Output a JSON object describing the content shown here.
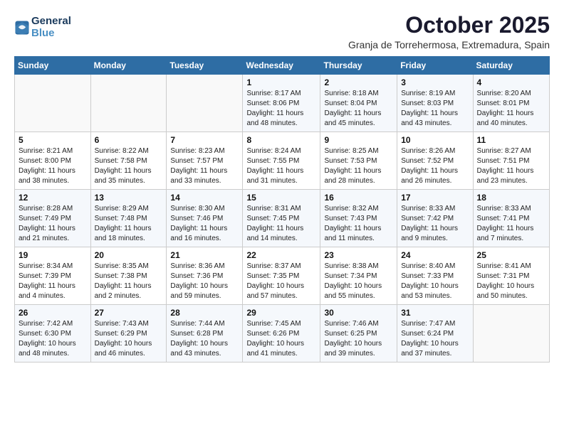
{
  "logo": {
    "line1": "General",
    "line2": "Blue"
  },
  "title": "October 2025",
  "subtitle": "Granja de Torrehermosa, Extremadura, Spain",
  "weekdays": [
    "Sunday",
    "Monday",
    "Tuesday",
    "Wednesday",
    "Thursday",
    "Friday",
    "Saturday"
  ],
  "weeks": [
    [
      {
        "day": "",
        "info": ""
      },
      {
        "day": "",
        "info": ""
      },
      {
        "day": "",
        "info": ""
      },
      {
        "day": "1",
        "info": "Sunrise: 8:17 AM\nSunset: 8:06 PM\nDaylight: 11 hours\nand 48 minutes."
      },
      {
        "day": "2",
        "info": "Sunrise: 8:18 AM\nSunset: 8:04 PM\nDaylight: 11 hours\nand 45 minutes."
      },
      {
        "day": "3",
        "info": "Sunrise: 8:19 AM\nSunset: 8:03 PM\nDaylight: 11 hours\nand 43 minutes."
      },
      {
        "day": "4",
        "info": "Sunrise: 8:20 AM\nSunset: 8:01 PM\nDaylight: 11 hours\nand 40 minutes."
      }
    ],
    [
      {
        "day": "5",
        "info": "Sunrise: 8:21 AM\nSunset: 8:00 PM\nDaylight: 11 hours\nand 38 minutes."
      },
      {
        "day": "6",
        "info": "Sunrise: 8:22 AM\nSunset: 7:58 PM\nDaylight: 11 hours\nand 35 minutes."
      },
      {
        "day": "7",
        "info": "Sunrise: 8:23 AM\nSunset: 7:57 PM\nDaylight: 11 hours\nand 33 minutes."
      },
      {
        "day": "8",
        "info": "Sunrise: 8:24 AM\nSunset: 7:55 PM\nDaylight: 11 hours\nand 31 minutes."
      },
      {
        "day": "9",
        "info": "Sunrise: 8:25 AM\nSunset: 7:53 PM\nDaylight: 11 hours\nand 28 minutes."
      },
      {
        "day": "10",
        "info": "Sunrise: 8:26 AM\nSunset: 7:52 PM\nDaylight: 11 hours\nand 26 minutes."
      },
      {
        "day": "11",
        "info": "Sunrise: 8:27 AM\nSunset: 7:51 PM\nDaylight: 11 hours\nand 23 minutes."
      }
    ],
    [
      {
        "day": "12",
        "info": "Sunrise: 8:28 AM\nSunset: 7:49 PM\nDaylight: 11 hours\nand 21 minutes."
      },
      {
        "day": "13",
        "info": "Sunrise: 8:29 AM\nSunset: 7:48 PM\nDaylight: 11 hours\nand 18 minutes."
      },
      {
        "day": "14",
        "info": "Sunrise: 8:30 AM\nSunset: 7:46 PM\nDaylight: 11 hours\nand 16 minutes."
      },
      {
        "day": "15",
        "info": "Sunrise: 8:31 AM\nSunset: 7:45 PM\nDaylight: 11 hours\nand 14 minutes."
      },
      {
        "day": "16",
        "info": "Sunrise: 8:32 AM\nSunset: 7:43 PM\nDaylight: 11 hours\nand 11 minutes."
      },
      {
        "day": "17",
        "info": "Sunrise: 8:33 AM\nSunset: 7:42 PM\nDaylight: 11 hours\nand 9 minutes."
      },
      {
        "day": "18",
        "info": "Sunrise: 8:33 AM\nSunset: 7:41 PM\nDaylight: 11 hours\nand 7 minutes."
      }
    ],
    [
      {
        "day": "19",
        "info": "Sunrise: 8:34 AM\nSunset: 7:39 PM\nDaylight: 11 hours\nand 4 minutes."
      },
      {
        "day": "20",
        "info": "Sunrise: 8:35 AM\nSunset: 7:38 PM\nDaylight: 11 hours\nand 2 minutes."
      },
      {
        "day": "21",
        "info": "Sunrise: 8:36 AM\nSunset: 7:36 PM\nDaylight: 10 hours\nand 59 minutes."
      },
      {
        "day": "22",
        "info": "Sunrise: 8:37 AM\nSunset: 7:35 PM\nDaylight: 10 hours\nand 57 minutes."
      },
      {
        "day": "23",
        "info": "Sunrise: 8:38 AM\nSunset: 7:34 PM\nDaylight: 10 hours\nand 55 minutes."
      },
      {
        "day": "24",
        "info": "Sunrise: 8:40 AM\nSunset: 7:33 PM\nDaylight: 10 hours\nand 53 minutes."
      },
      {
        "day": "25",
        "info": "Sunrise: 8:41 AM\nSunset: 7:31 PM\nDaylight: 10 hours\nand 50 minutes."
      }
    ],
    [
      {
        "day": "26",
        "info": "Sunrise: 7:42 AM\nSunset: 6:30 PM\nDaylight: 10 hours\nand 48 minutes."
      },
      {
        "day": "27",
        "info": "Sunrise: 7:43 AM\nSunset: 6:29 PM\nDaylight: 10 hours\nand 46 minutes."
      },
      {
        "day": "28",
        "info": "Sunrise: 7:44 AM\nSunset: 6:28 PM\nDaylight: 10 hours\nand 43 minutes."
      },
      {
        "day": "29",
        "info": "Sunrise: 7:45 AM\nSunset: 6:26 PM\nDaylight: 10 hours\nand 41 minutes."
      },
      {
        "day": "30",
        "info": "Sunrise: 7:46 AM\nSunset: 6:25 PM\nDaylight: 10 hours\nand 39 minutes."
      },
      {
        "day": "31",
        "info": "Sunrise: 7:47 AM\nSunset: 6:24 PM\nDaylight: 10 hours\nand 37 minutes."
      },
      {
        "day": "",
        "info": ""
      }
    ]
  ]
}
